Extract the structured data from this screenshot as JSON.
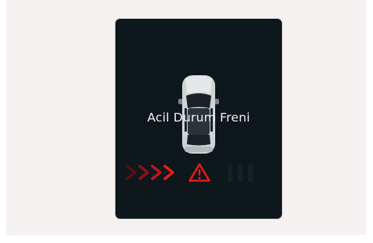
{
  "alert": {
    "label": "Acil Durum Freni"
  },
  "icons": {
    "vehicle": "car-top-view-icon",
    "warning": "warning-triangle-icon",
    "direction": "chevron-right-icon"
  },
  "colors": {
    "display_background": "#0e171c",
    "warning_red": "#e51b1b",
    "text": "#f2f2f2"
  }
}
